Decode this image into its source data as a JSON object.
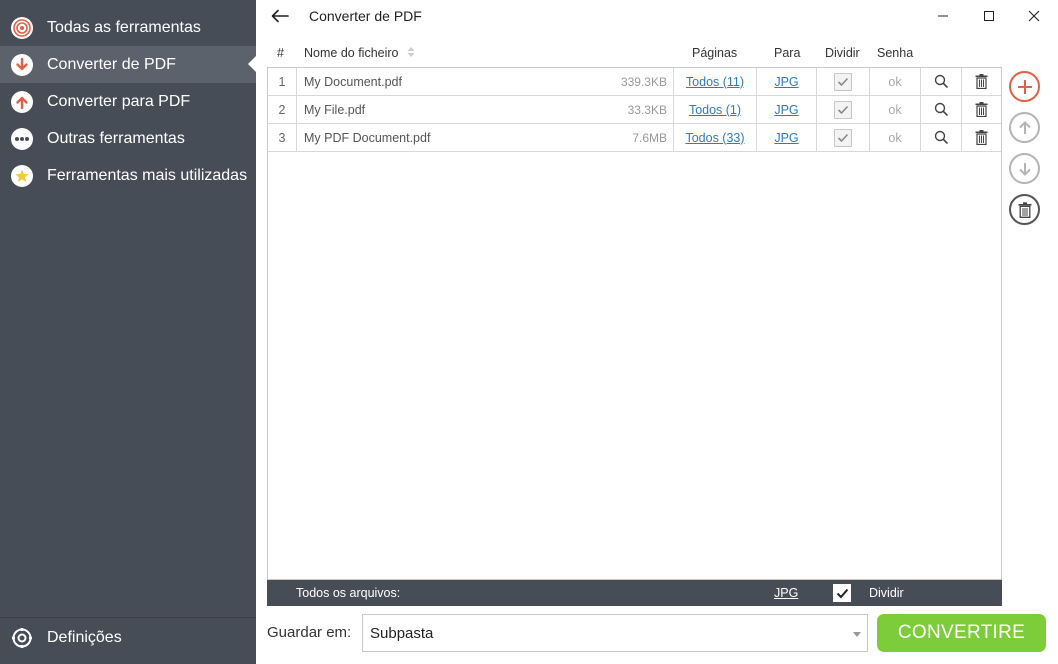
{
  "sidebar": {
    "items": [
      {
        "label": "Todas as ferramentas",
        "icon": "target-icon",
        "color": "#e0604a"
      },
      {
        "label": "Converter de PDF",
        "icon": "arrow-down-icon",
        "color": "#e0604a",
        "active": true
      },
      {
        "label": "Converter para PDF",
        "icon": "arrow-up-icon",
        "color": "#e0604a"
      },
      {
        "label": "Outras ferramentas",
        "icon": "more-icon",
        "color": "#ffffff"
      },
      {
        "label": "Ferramentas mais utilizadas",
        "icon": "star-icon",
        "color": "#f3cc3a"
      }
    ],
    "settings_label": "Definições"
  },
  "titlebar": {
    "title": "Converter de PDF"
  },
  "table": {
    "headers": {
      "num": "#",
      "name": "Nome do ficheiro",
      "pages": "Páginas",
      "to": "Para",
      "split": "Dividir",
      "password": "Senha"
    },
    "rows": [
      {
        "num": "1",
        "name": "My Document.pdf",
        "size": "339.3KB",
        "pages": "Todos (11)",
        "to": "JPG",
        "split": true,
        "password": "ok"
      },
      {
        "num": "2",
        "name": "My File.pdf",
        "size": "33.3KB",
        "pages": "Todos (1)",
        "to": "JPG",
        "split": true,
        "password": "ok"
      },
      {
        "num": "3",
        "name": "My PDF Document.pdf",
        "size": "7.6MB",
        "pages": "Todos (33)",
        "to": "JPG",
        "split": true,
        "password": "ok"
      }
    ]
  },
  "footer": {
    "all_files_label": "Todos os arquivos:",
    "format": "JPG",
    "split_label": "Dividir",
    "split_checked": true
  },
  "save": {
    "label": "Guardar em:",
    "value": "Subpasta"
  },
  "convert_label": "CONVERTIRE",
  "colors": {
    "sidebar_bg": "#474d56",
    "accent_red": "#e0604a",
    "convert_green": "#7dcc3a",
    "link_blue": "#2f7bbf"
  }
}
